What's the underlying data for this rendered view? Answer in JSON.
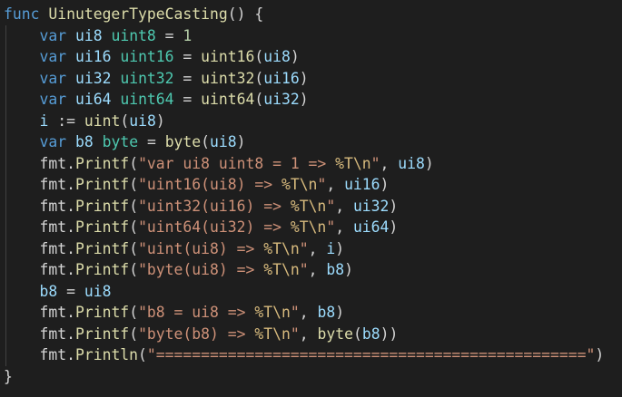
{
  "editor": {
    "language": "go",
    "colors": {
      "background": "#1e1e1e",
      "keyword": "#569cd6",
      "function": "#dcdcaa",
      "type": "#4ec9b0",
      "variable": "#9cdcfe",
      "string": "#ce9178",
      "escape": "#d7ba7d",
      "number": "#b5cea8",
      "default": "#d4d4d4"
    },
    "lines": [
      [
        [
          "kw",
          "func"
        ],
        [
          "op",
          " "
        ],
        [
          "fn",
          "UinutegerTypeCasting"
        ],
        [
          "op",
          "() {"
        ]
      ],
      [
        [
          "op",
          "    "
        ],
        [
          "kw",
          "var"
        ],
        [
          "op",
          " "
        ],
        [
          "vr",
          "ui8"
        ],
        [
          "op",
          " "
        ],
        [
          "ty",
          "uint8"
        ],
        [
          "op",
          " = "
        ],
        [
          "nu",
          "1"
        ]
      ],
      [
        [
          "op",
          "    "
        ],
        [
          "kw",
          "var"
        ],
        [
          "op",
          " "
        ],
        [
          "vr",
          "ui16"
        ],
        [
          "op",
          " "
        ],
        [
          "ty",
          "uint16"
        ],
        [
          "op",
          " = "
        ],
        [
          "fn",
          "uint16"
        ],
        [
          "op",
          "("
        ],
        [
          "vr",
          "ui8"
        ],
        [
          "op",
          ")"
        ]
      ],
      [
        [
          "op",
          "    "
        ],
        [
          "kw",
          "var"
        ],
        [
          "op",
          " "
        ],
        [
          "vr",
          "ui32"
        ],
        [
          "op",
          " "
        ],
        [
          "ty",
          "uint32"
        ],
        [
          "op",
          " = "
        ],
        [
          "fn",
          "uint32"
        ],
        [
          "op",
          "("
        ],
        [
          "vr",
          "ui16"
        ],
        [
          "op",
          ")"
        ]
      ],
      [
        [
          "op",
          "    "
        ],
        [
          "kw",
          "var"
        ],
        [
          "op",
          " "
        ],
        [
          "vr",
          "ui64"
        ],
        [
          "op",
          " "
        ],
        [
          "ty",
          "uint64"
        ],
        [
          "op",
          " = "
        ],
        [
          "fn",
          "uint64"
        ],
        [
          "op",
          "("
        ],
        [
          "vr",
          "ui32"
        ],
        [
          "op",
          ")"
        ]
      ],
      [
        [
          "op",
          "    "
        ],
        [
          "vr",
          "i"
        ],
        [
          "op",
          " := "
        ],
        [
          "fn",
          "uint"
        ],
        [
          "op",
          "("
        ],
        [
          "vr",
          "ui8"
        ],
        [
          "op",
          ")"
        ]
      ],
      [
        [
          "op",
          "    "
        ],
        [
          "kw",
          "var"
        ],
        [
          "op",
          " "
        ],
        [
          "vr",
          "b8"
        ],
        [
          "op",
          " "
        ],
        [
          "ty",
          "byte"
        ],
        [
          "op",
          " = "
        ],
        [
          "fn",
          "byte"
        ],
        [
          "op",
          "("
        ],
        [
          "vr",
          "ui8"
        ],
        [
          "op",
          ")"
        ]
      ],
      [
        [
          "op",
          "    "
        ],
        [
          "pk",
          "fmt"
        ],
        [
          "op",
          "."
        ],
        [
          "fn",
          "Printf"
        ],
        [
          "op",
          "("
        ],
        [
          "st",
          "\"var ui8 uint8 = 1 => "
        ],
        [
          "es",
          "%T\\n"
        ],
        [
          "st",
          "\""
        ],
        [
          "op",
          ", "
        ],
        [
          "vr",
          "ui8"
        ],
        [
          "op",
          ")"
        ]
      ],
      [
        [
          "op",
          "    "
        ],
        [
          "pk",
          "fmt"
        ],
        [
          "op",
          "."
        ],
        [
          "fn",
          "Printf"
        ],
        [
          "op",
          "("
        ],
        [
          "st",
          "\"uint16(ui8) => "
        ],
        [
          "es",
          "%T\\n"
        ],
        [
          "st",
          "\""
        ],
        [
          "op",
          ", "
        ],
        [
          "vr",
          "ui16"
        ],
        [
          "op",
          ")"
        ]
      ],
      [
        [
          "op",
          "    "
        ],
        [
          "pk",
          "fmt"
        ],
        [
          "op",
          "."
        ],
        [
          "fn",
          "Printf"
        ],
        [
          "op",
          "("
        ],
        [
          "st",
          "\"uint32(ui16) => "
        ],
        [
          "es",
          "%T\\n"
        ],
        [
          "st",
          "\""
        ],
        [
          "op",
          ", "
        ],
        [
          "vr",
          "ui32"
        ],
        [
          "op",
          ")"
        ]
      ],
      [
        [
          "op",
          "    "
        ],
        [
          "pk",
          "fmt"
        ],
        [
          "op",
          "."
        ],
        [
          "fn",
          "Printf"
        ],
        [
          "op",
          "("
        ],
        [
          "st",
          "\"uint64(ui32) => "
        ],
        [
          "es",
          "%T\\n"
        ],
        [
          "st",
          "\""
        ],
        [
          "op",
          ", "
        ],
        [
          "vr",
          "ui64"
        ],
        [
          "op",
          ")"
        ]
      ],
      [
        [
          "op",
          "    "
        ],
        [
          "pk",
          "fmt"
        ],
        [
          "op",
          "."
        ],
        [
          "fn",
          "Printf"
        ],
        [
          "op",
          "("
        ],
        [
          "st",
          "\"uint(ui8) => "
        ],
        [
          "es",
          "%T\\n"
        ],
        [
          "st",
          "\""
        ],
        [
          "op",
          ", "
        ],
        [
          "vr",
          "i"
        ],
        [
          "op",
          ")"
        ]
      ],
      [
        [
          "op",
          "    "
        ],
        [
          "pk",
          "fmt"
        ],
        [
          "op",
          "."
        ],
        [
          "fn",
          "Printf"
        ],
        [
          "op",
          "("
        ],
        [
          "st",
          "\"byte(ui8) => "
        ],
        [
          "es",
          "%T\\n"
        ],
        [
          "st",
          "\""
        ],
        [
          "op",
          ", "
        ],
        [
          "vr",
          "b8"
        ],
        [
          "op",
          ")"
        ]
      ],
      [
        [
          "op",
          "    "
        ],
        [
          "vr",
          "b8"
        ],
        [
          "op",
          " = "
        ],
        [
          "vr",
          "ui8"
        ]
      ],
      [
        [
          "op",
          "    "
        ],
        [
          "pk",
          "fmt"
        ],
        [
          "op",
          "."
        ],
        [
          "fn",
          "Printf"
        ],
        [
          "op",
          "("
        ],
        [
          "st",
          "\"b8 = ui8 => "
        ],
        [
          "es",
          "%T\\n"
        ],
        [
          "st",
          "\""
        ],
        [
          "op",
          ", "
        ],
        [
          "vr",
          "b8"
        ],
        [
          "op",
          ")"
        ]
      ],
      [
        [
          "op",
          "    "
        ],
        [
          "pk",
          "fmt"
        ],
        [
          "op",
          "."
        ],
        [
          "fn",
          "Printf"
        ],
        [
          "op",
          "("
        ],
        [
          "st",
          "\"byte(b8) => "
        ],
        [
          "es",
          "%T\\n"
        ],
        [
          "st",
          "\""
        ],
        [
          "op",
          ", "
        ],
        [
          "fn",
          "byte"
        ],
        [
          "op",
          "("
        ],
        [
          "vr",
          "b8"
        ],
        [
          "op",
          "))"
        ]
      ],
      [
        [
          "op",
          "    "
        ],
        [
          "pk",
          "fmt"
        ],
        [
          "op",
          "."
        ],
        [
          "fn",
          "Println"
        ],
        [
          "op",
          "("
        ],
        [
          "st",
          "\"================================================\""
        ],
        [
          "op",
          ")"
        ]
      ],
      [
        [
          "op",
          "}"
        ]
      ]
    ]
  }
}
